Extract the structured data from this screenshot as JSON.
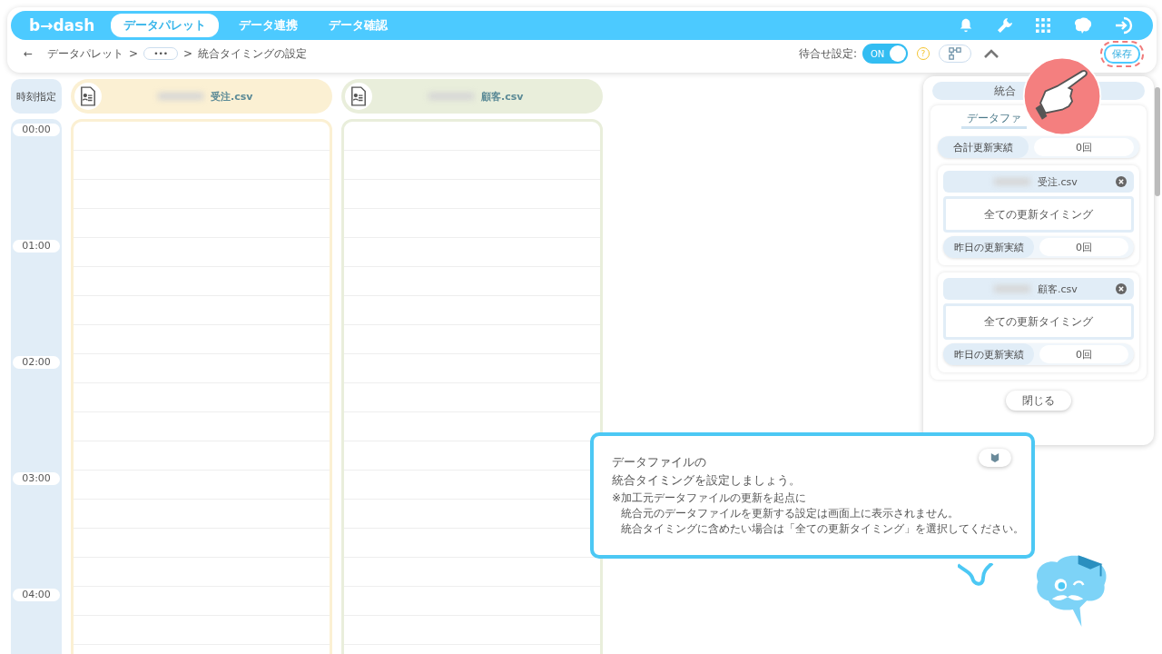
{
  "header": {
    "logo": "b→dash",
    "nav": [
      {
        "label": "データパレット",
        "selected": true
      },
      {
        "label": "データ連携",
        "selected": false
      },
      {
        "label": "データ確認",
        "selected": false
      }
    ]
  },
  "breadcrumb": {
    "back": "←",
    "root": "データパレット",
    "sep1": ">",
    "more": "•••",
    "sep2": ">",
    "current": "統合タイミングの設定"
  },
  "toolbar": {
    "wait_label": "待合せ設定:",
    "toggle": {
      "label": "ON",
      "on": true
    },
    "help": "?",
    "save": "保存"
  },
  "time_column": {
    "header": "時刻指定",
    "times": [
      "00:00",
      "01:00",
      "02:00",
      "03:00",
      "04:00"
    ]
  },
  "files": [
    {
      "name": "受注.csv",
      "color": "#fbf0d3"
    },
    {
      "name": "顧客.csv",
      "color": "#e9eedb"
    }
  ],
  "panel": {
    "title": "統合",
    "subtitle": "データファ",
    "total": {
      "label": "合計更新実績",
      "value": "0回"
    },
    "files": [
      {
        "name": "受注.csv",
        "timing": "全ての更新タイミング",
        "yesterday_label": "昨日の更新実績",
        "yesterday_value": "0回"
      },
      {
        "name": "顧客.csv",
        "timing": "全ての更新タイミング",
        "yesterday_label": "昨日の更新実績",
        "yesterday_value": "0回"
      }
    ],
    "close": "閉じる"
  },
  "tip": {
    "title_lines": [
      "データファイルの",
      "統合タイミングを設定しましょう。"
    ],
    "notes": [
      "※加工元データファイルの更新を起点に",
      "統合元のデータファイルを更新する設定は画面上に表示されません。",
      "統合タイミングに含めたい場合は「全ての更新タイミング」を選択してください。"
    ]
  }
}
